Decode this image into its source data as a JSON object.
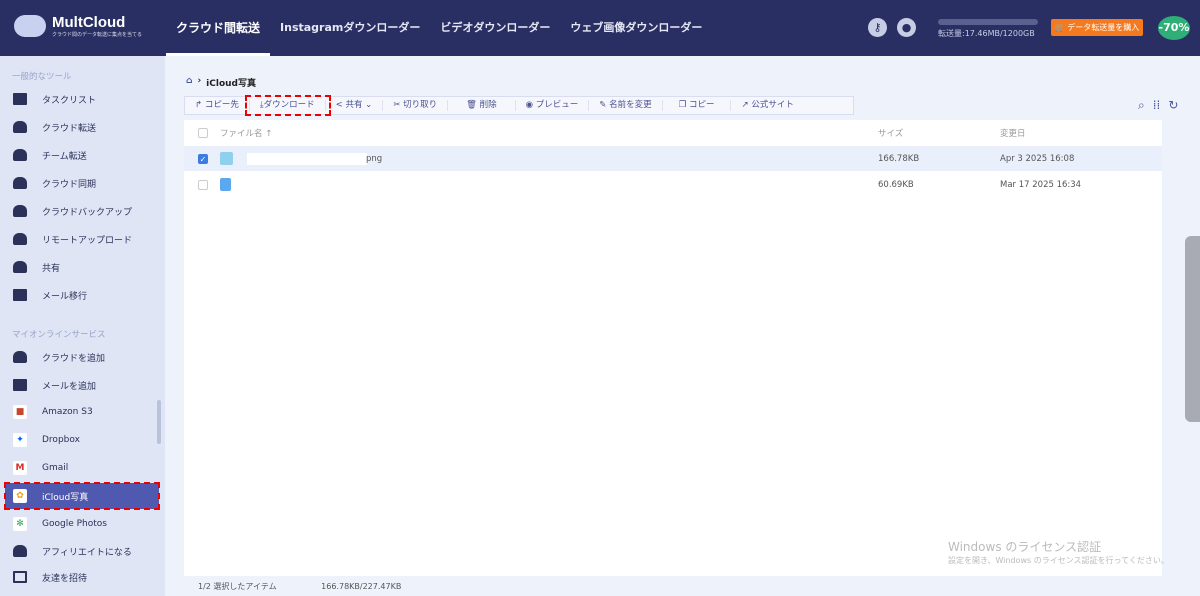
{
  "header": {
    "logo": "MultCloud",
    "tagline": "クラウド間のデータ転送に集点を当てる",
    "nav": [
      "クラウド間転送",
      "Instagramダウンローダー",
      "ビデオダウンローダー",
      "ウェブ画像ダウンローダー"
    ],
    "usage": "転送量:17.46MB/1200GB",
    "buy": "データ転送量を購入",
    "discount": "-70%"
  },
  "sidebar": {
    "section1": "一般的なツール",
    "tools": [
      "タスクリスト",
      "クラウド転送",
      "チーム転送",
      "クラウド同期",
      "クラウドバックアップ",
      "リモートアップロード",
      "共有",
      "メール移行"
    ],
    "section2": "マイオンラインサービス",
    "services": [
      "クラウドを追加",
      "メールを追加",
      "Amazon S3",
      "Dropbox",
      "Gmail",
      "iCloud写真",
      "Google Photos",
      "アフィリエイトになる",
      "友達を招待"
    ]
  },
  "breadcrumb": {
    "current": "iCloud写真"
  },
  "toolbar": [
    "コピー先",
    "ダウンロード",
    "共有",
    "切り取り",
    "削除",
    "プレビュー",
    "名前を変更",
    "コピー",
    "公式サイト"
  ],
  "table": {
    "headers": [
      "ファイル名",
      "サイズ",
      "変更日"
    ],
    "rows": [
      {
        "name": "png",
        "size": "166.78KB",
        "date": "Apr 3 2025 16:08",
        "checked": true
      },
      {
        "name": "",
        "size": "60.69KB",
        "date": "Mar 17 2025 16:34",
        "checked": false
      }
    ]
  },
  "status": {
    "selected": "1/2 選択したアイテム",
    "size": "166.78KB/227.47KB"
  },
  "watermark": {
    "title": "Windows のライセンス認証",
    "sub": "設定を開き、Windows のライセンス認証を行ってください。"
  }
}
